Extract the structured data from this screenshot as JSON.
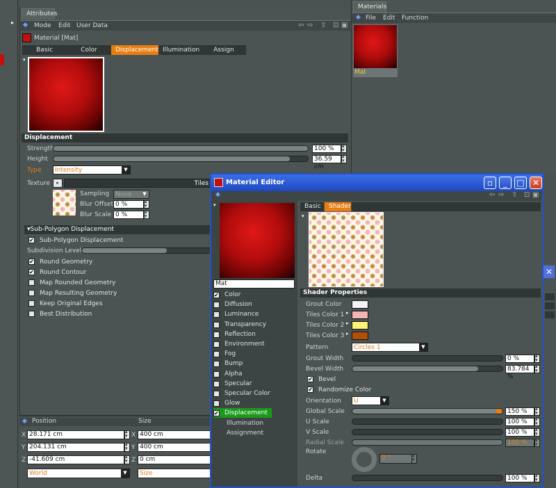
{
  "attributes": {
    "tab": "Attributes",
    "menu": [
      "Mode",
      "Edit",
      "User Data"
    ],
    "material_title": "Material [Mat]",
    "tabs": [
      "Basic",
      "Color",
      "Displacement",
      "Illumination",
      "Assign"
    ],
    "active_tab": "Displacement",
    "section_displacement": "Displacement",
    "strength_label": "Strength",
    "strength_value": "100 %",
    "strength_fraction": 1.0,
    "height_label": "Height",
    "height_value": "36.59 cm",
    "height_fraction": 0.93,
    "type_label": "Type",
    "type_value": "Intensity",
    "texture_label": "Texture",
    "texture_value": "Tiles",
    "sampling_label": "Sampling",
    "sampling_value": "None",
    "blur_offset_label": "Blur Offset",
    "blur_offset_value": "0 %",
    "blur_scale_label": "Blur Scale",
    "blur_scale_value": "0 %",
    "subpoly_header": "Sub-Polygon Displacement",
    "subpoly_checkbox": "Sub-Polygon Displacement",
    "subdivision_label": "Subdivision Level",
    "subdivision_fraction": 0.65,
    "options": [
      {
        "label": "Round Geometry",
        "checked": true
      },
      {
        "label": "Round Contour",
        "checked": true
      },
      {
        "label": "Map Rounded Geometry",
        "checked": false
      },
      {
        "label": "Map Resulting Geometry",
        "checked": false
      },
      {
        "label": "Keep Original Edges",
        "checked": false
      },
      {
        "label": "Best Distribution",
        "checked": false
      }
    ]
  },
  "coords": {
    "position_label": "Position",
    "size_label": "Size",
    "x_label": "X",
    "y_label": "Y",
    "z_label": "Z",
    "pos_x": "28.171 cm",
    "pos_y": "204.131 cm",
    "pos_z": "-41.609 cm",
    "size_x": "400 cm",
    "size_y": "400 cm",
    "size_z": "0 cm",
    "mode_value": "World",
    "size_mode": "Size"
  },
  "materials": {
    "tab": "Materials",
    "menu": [
      "File",
      "Edit",
      "Function"
    ],
    "thumb_label": "Mat"
  },
  "editor": {
    "title": "Material Editor",
    "name_field": "Mat",
    "channels": [
      {
        "label": "Color",
        "checked": true
      },
      {
        "label": "Diffusion",
        "checked": false
      },
      {
        "label": "Luminance",
        "checked": false
      },
      {
        "label": "Transparency",
        "checked": false
      },
      {
        "label": "Reflection",
        "checked": false
      },
      {
        "label": "Environment",
        "checked": false
      },
      {
        "label": "Fog",
        "checked": false
      },
      {
        "label": "Bump",
        "checked": false
      },
      {
        "label": "Alpha",
        "checked": false
      },
      {
        "label": "Specular",
        "checked": false
      },
      {
        "label": "Specular Color",
        "checked": false
      },
      {
        "label": "Glow",
        "checked": false
      },
      {
        "label": "Displacement",
        "checked": true
      }
    ],
    "sub_items": [
      "Illumination",
      "Assignment"
    ],
    "tabs": [
      "Basic",
      "Shader"
    ],
    "shader_header": "Shader Properties",
    "grout_color_label": "Grout Color",
    "tiles1_label": "Tiles Color 1",
    "tiles2_label": "Tiles Color 2",
    "tiles3_label": "Tiles Color 3",
    "colors": {
      "grout": "#f4f4f4",
      "tiles1": "#f5b4b4",
      "tiles2": "#fbf37a",
      "tiles3": "#b05008"
    },
    "pattern_label": "Pattern",
    "pattern_value": "Circles 1",
    "grout_width_label": "Grout Width",
    "grout_width_value": "0 %",
    "grout_width_fraction": 0.0,
    "bevel_width_label": "Bevel Width",
    "bevel_width_value": "83.784 %",
    "bevel_width_fraction": 0.84,
    "bevel_label": "Bevel",
    "randomize_label": "Randomize Color",
    "orientation_label": "Orientation",
    "orientation_value": "U",
    "global_scale_label": "Global Scale",
    "global_scale_value": "150 %",
    "global_scale_fraction": 1.0,
    "u_scale_label": "U Scale",
    "u_scale_value": "100 %",
    "v_scale_label": "V Scale",
    "v_scale_value": "100 %",
    "radial_scale_label": "Radial Scale",
    "radial_scale_value": "100 %",
    "rotate_label": "Rotate",
    "rotate_value": "0 °",
    "delta_label": "Delta",
    "delta_value": "100 %"
  },
  "colors": {
    "accent": "#e87d12",
    "title_bar": "#2352c9",
    "active_green": "#1a9a1a"
  }
}
